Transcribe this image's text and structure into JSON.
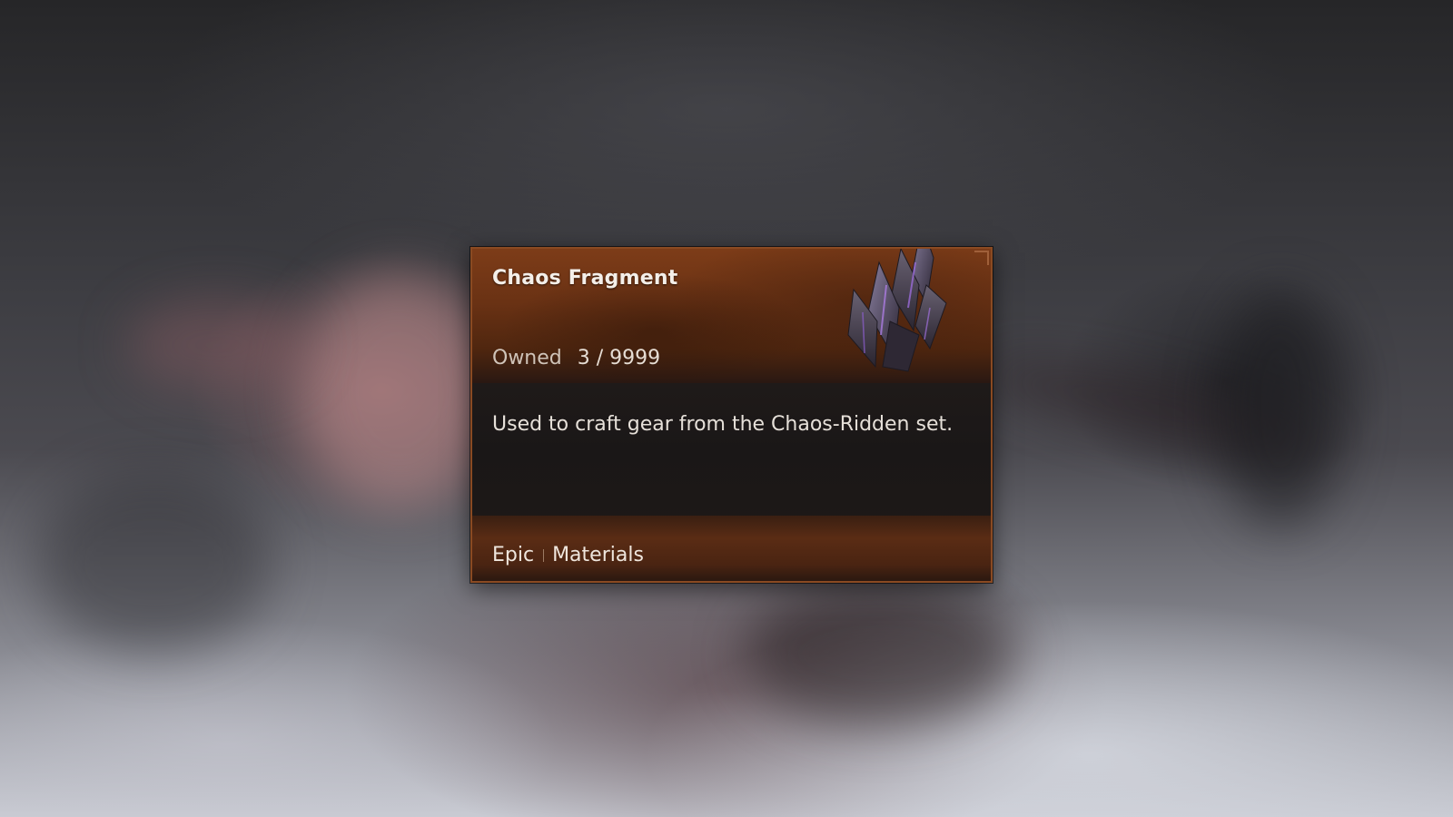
{
  "tooltip": {
    "item_name": "Chaos Fragment",
    "owned_label": "Owned",
    "owned_value": "3 / 9999",
    "description": "Used to craft gear from the Chaos-Ridden set.",
    "rarity": "Epic",
    "category": "Materials",
    "icon": "dark-crystal-shard-icon"
  },
  "colors": {
    "header_bg": "#6a3214",
    "body_bg": "#1a1717",
    "border": "#8a4a22",
    "crystal": "#4b4356",
    "crystal_glow": "#9a6bd8"
  }
}
